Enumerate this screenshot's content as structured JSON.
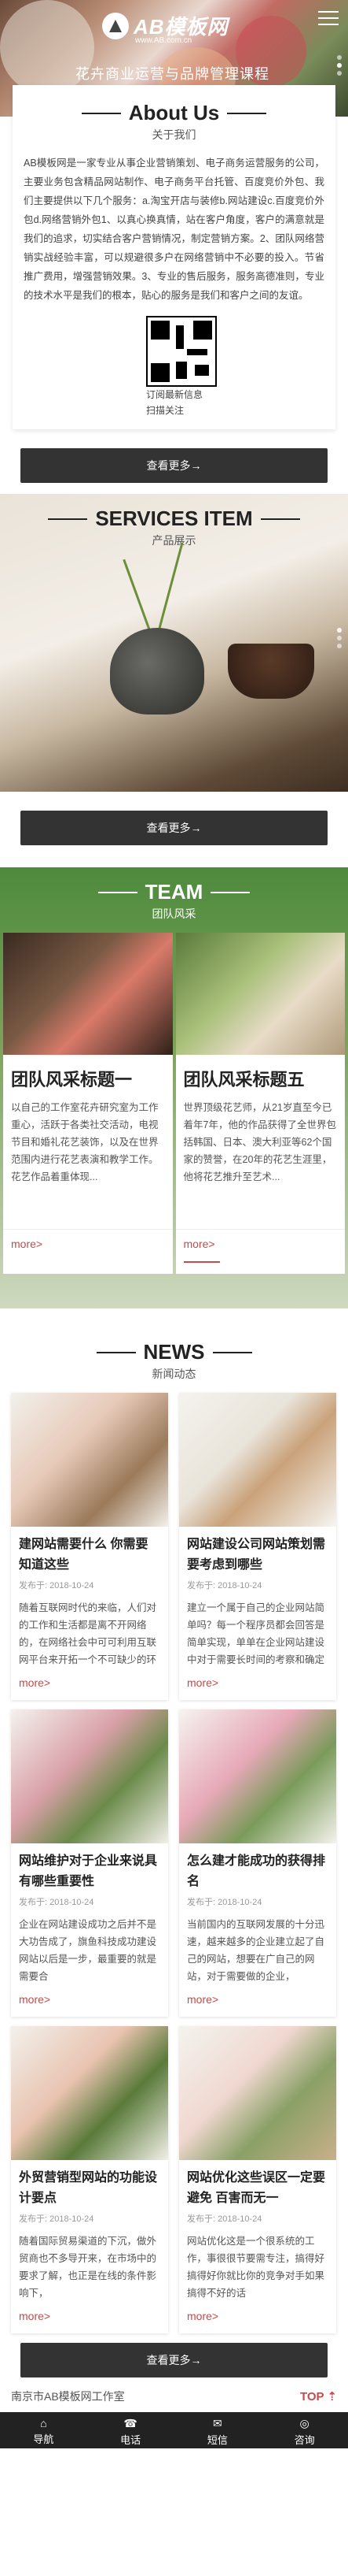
{
  "header": {
    "logo_text": "AB模板网",
    "logo_sub": "www.AB.com.cn",
    "hero_title": "花卉商业运营与品牌管理课程"
  },
  "about": {
    "en": "About Us",
    "cn": "关于我们",
    "text": "AB模板网是一家专业从事企业营销策划、电子商务运营服务的公司，主要业务包含精品网站制作、电子商务平台托管、百度竞价外包、我们主要提供以下几个服务：a.淘宝开店与装修b.网站建设c.百度竞价外包d.网络营销外包1、以真心换真情，站在客户角度，客户的满意就是我们的追求，切实结合客户营销情况，制定营销方案。2、团队网络营销实战经验丰富，可以规避很多户在网络营销中不必要的投入。节省推广费用，增强营销效果。3、专业的售后服务，服务高德准则，专业的技术水平是我们的根本，贴心的服务是我们和客户之间的友谊。",
    "qr_caption_1": "订阅最新信息",
    "qr_caption_2": "扫描关注",
    "more": "查看更多→"
  },
  "services": {
    "en": "SERVICES ITEM",
    "cn": "产品展示",
    "more": "查看更多→"
  },
  "team": {
    "en": "TEAM",
    "cn": "团队风采",
    "cards": [
      {
        "title": "团队风采标题一",
        "text": "以自己的工作室花卉研究室为工作重心，活跃于各类社交活动，电视节目和婚礼花艺装饰，以及在世界范围内进行花艺表演和教学工作。花艺作品着重体现...",
        "more": "more>"
      },
      {
        "title": "团队风采标题五",
        "text": "世界顶级花艺师，从21岁直至今已着年7年，他的作品获得了全世界包括韩国、日本、澳大利亚等62个国家的赞誉，在20年的花艺生涯里，他将花艺推升至艺术...",
        "more": "more>"
      }
    ]
  },
  "news": {
    "en": "NEWS",
    "cn": "新闻动态",
    "items": [
      {
        "title": "建网站需要什么 你需要知道这些",
        "date": "发布于: 2018-10-24",
        "text": "随着互联网时代的来临，人们对的工作和生活都是离不开网络的，在网络社会中可可利用互联网平台来开拓一个不可缺少的环节，目前网络上面的",
        "more": "more>"
      },
      {
        "title": "网站建设公司网站策划需要考虑到哪些",
        "date": "发布于: 2018-10-24",
        "text": "建立一个属于自己的企业网站简单吗？每一个程序员都会回答是简单实现，单单在企业网站建设中对于需要长时间的考察和确定",
        "more": "more>"
      },
      {
        "title": "网站维护对于企业来说具有哪些重要性",
        "date": "发布于: 2018-10-24",
        "text": "企业在网站建设成功之后并不是大功告成了，旗鱼科技成功建设网站以后是一步，最重要的就是需要合",
        "more": "more>"
      },
      {
        "title": "怎么建才能成功的获得排名",
        "date": "发布于: 2018-10-24",
        "text": "当前国内的互联网发展的十分迅速，越来越多的企业建立起了自己的网站，想要在广自己的网站，对于需要做的企业，",
        "more": "more>"
      },
      {
        "title": "外贸营销型网站的功能设计要点",
        "date": "发布于: 2018-10-24",
        "text": "随着国际贸易渠道的下沉，做外贸商也不多导开来，在市场中的要求了解，也正是在线的条件影响下，",
        "more": "more>"
      },
      {
        "title": "网站优化这些误区一定要避免 百害而无一",
        "date": "发布于: 2018-10-24",
        "text": "网站优化这是一个很系统的工作，事很很节要需专注，搞得好搞得好你就比你的竞争对手如果搞得不好的话",
        "more": "more>"
      }
    ],
    "more": "查看更多→"
  },
  "footer": {
    "company": "南京市AB模板网工作室",
    "top": "TOP",
    "nav": [
      {
        "icon": "⌂",
        "label": "导航"
      },
      {
        "icon": "☎",
        "label": "电话"
      },
      {
        "icon": "✉",
        "label": "短信"
      },
      {
        "icon": "◎",
        "label": "咨询"
      }
    ]
  }
}
